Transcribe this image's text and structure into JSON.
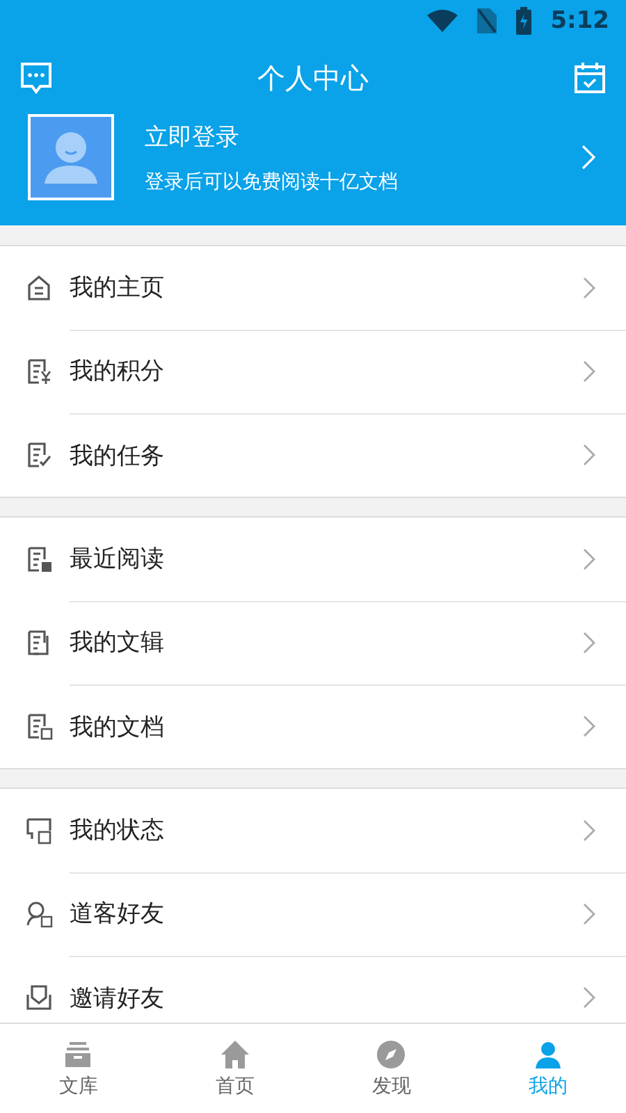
{
  "status_bar": {
    "time": "5:12"
  },
  "header": {
    "title": "个人中心"
  },
  "profile": {
    "login": "立即登录",
    "subtitle": "登录后可以免费阅读十亿文档"
  },
  "menu_groups": [
    [
      {
        "label": "我的主页"
      },
      {
        "label": "我的积分"
      },
      {
        "label": "我的任务"
      }
    ],
    [
      {
        "label": "最近阅读"
      },
      {
        "label": "我的文辑"
      },
      {
        "label": "我的文档"
      }
    ],
    [
      {
        "label": "我的状态"
      },
      {
        "label": "道客好友"
      },
      {
        "label": "邀请好友"
      }
    ]
  ],
  "bottom_nav": [
    {
      "label": "文库",
      "selected": false
    },
    {
      "label": "首页",
      "selected": false
    },
    {
      "label": "发现",
      "selected": false
    },
    {
      "label": "我的",
      "selected": true
    }
  ]
}
